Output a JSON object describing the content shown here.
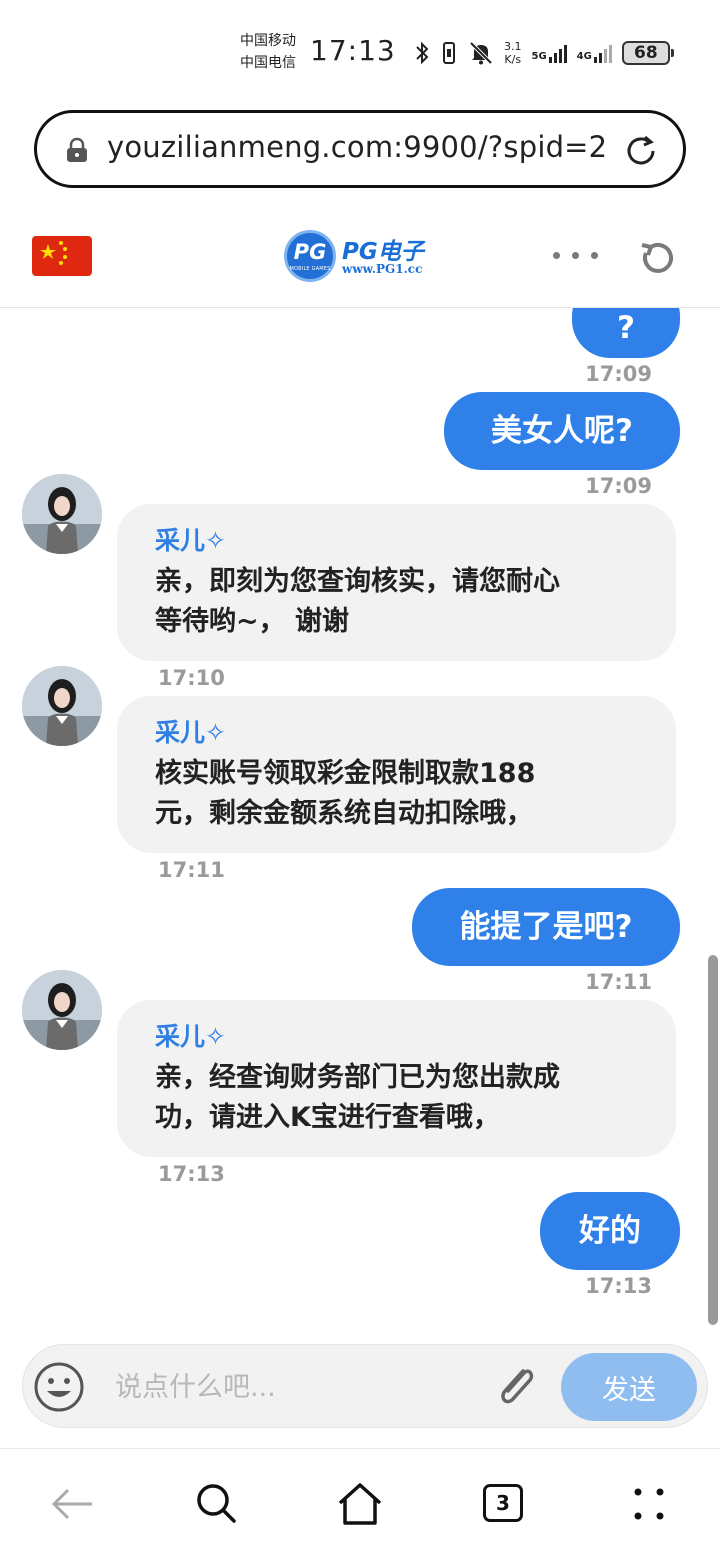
{
  "status_bar": {
    "carrier_1": "中国移动",
    "carrier_2": "中国电信",
    "time": "17:13",
    "speed_value": "3.1",
    "speed_unit": "K/s",
    "net_1": "5G",
    "net_2": "4G",
    "battery": "68"
  },
  "browser": {
    "url": "youzilianmeng.com:9900/?spid=2"
  },
  "site_header": {
    "logo_badge": "PG",
    "logo_badge_sub": "MOBILE GAMES",
    "logo_name": "PG电子",
    "logo_url": "www.PG1.cc"
  },
  "messages": [
    {
      "side": "out",
      "text": "?",
      "time": "17:09"
    },
    {
      "side": "out",
      "text": "美女人呢?",
      "time": "17:09"
    },
    {
      "side": "in",
      "name": "采儿✧",
      "text_lines": [
        "亲，即刻为您查询核实，请您耐心",
        "等待哟~， 谢谢"
      ],
      "time": "17:10"
    },
    {
      "side": "in",
      "name": "采儿✧",
      "text_lines": [
        "核实账号领取彩金限制取款188",
        "元，剩余金额系统自动扣除哦，"
      ],
      "time": "17:11"
    },
    {
      "side": "out",
      "text": "能提了是吧?",
      "time": "17:11"
    },
    {
      "side": "in",
      "name": "采儿✧",
      "text_lines": [
        "亲，经查询财务部门已为您出款成",
        "功，请进入K宝进行查看哦，"
      ],
      "time": "17:13"
    },
    {
      "side": "out",
      "text": "好的",
      "time": "17:13"
    }
  ],
  "composer": {
    "placeholder": "说点什么吧...",
    "send_label": "发送"
  },
  "bottom_nav": {
    "tab_count": "3"
  },
  "colors": {
    "accent_blue": "#2f80e8",
    "send_disabled": "#8fbdf0",
    "agent_bubble": "#f2f2f2"
  }
}
